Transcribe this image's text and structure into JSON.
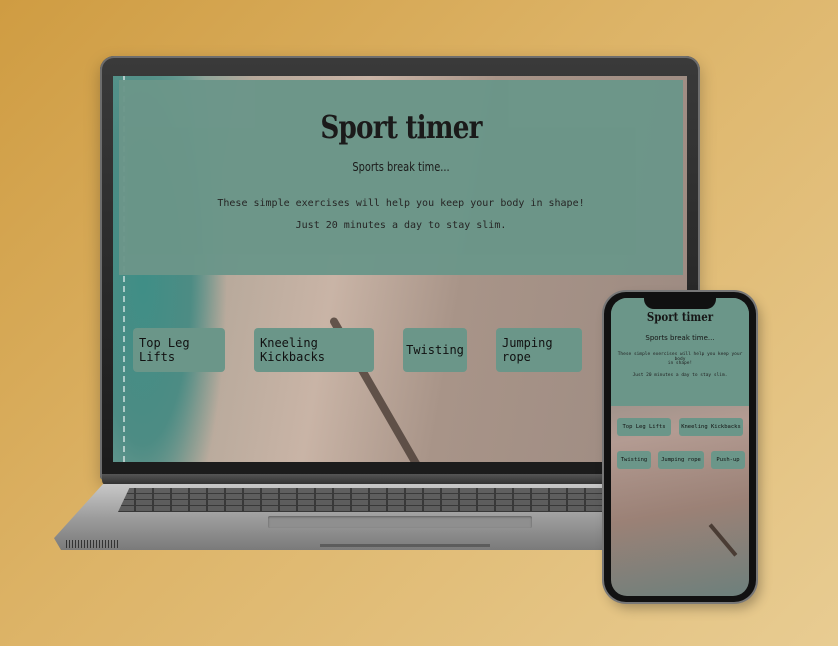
{
  "laptop_page": {
    "title": "Sport timer",
    "subtitle": "Sports break time...",
    "description_line1": "These simple exercises will help you keep your body in shape!",
    "description_line2": "Just 20 minutes a day to stay slim.",
    "exercises": [
      "Top Leg Lifts",
      "Kneeling Kickbacks",
      "Twisting",
      "Jumping rope"
    ]
  },
  "phone_page": {
    "title": "Sport timer",
    "subtitle": "Sports break time...",
    "description_line1a": "These simple exercises will help you keep your body",
    "description_line1b": "in shape!",
    "description_line2": "Just 20 minutes a day to stay slim.",
    "exercises": [
      "Top Leg Lifts",
      "Kneeling Kickbacks",
      "Twisting",
      "Jumping rope",
      "Push-up"
    ]
  },
  "colors": {
    "accent": "#6b9689",
    "background": "#d9ae5e",
    "text": "#161616"
  }
}
